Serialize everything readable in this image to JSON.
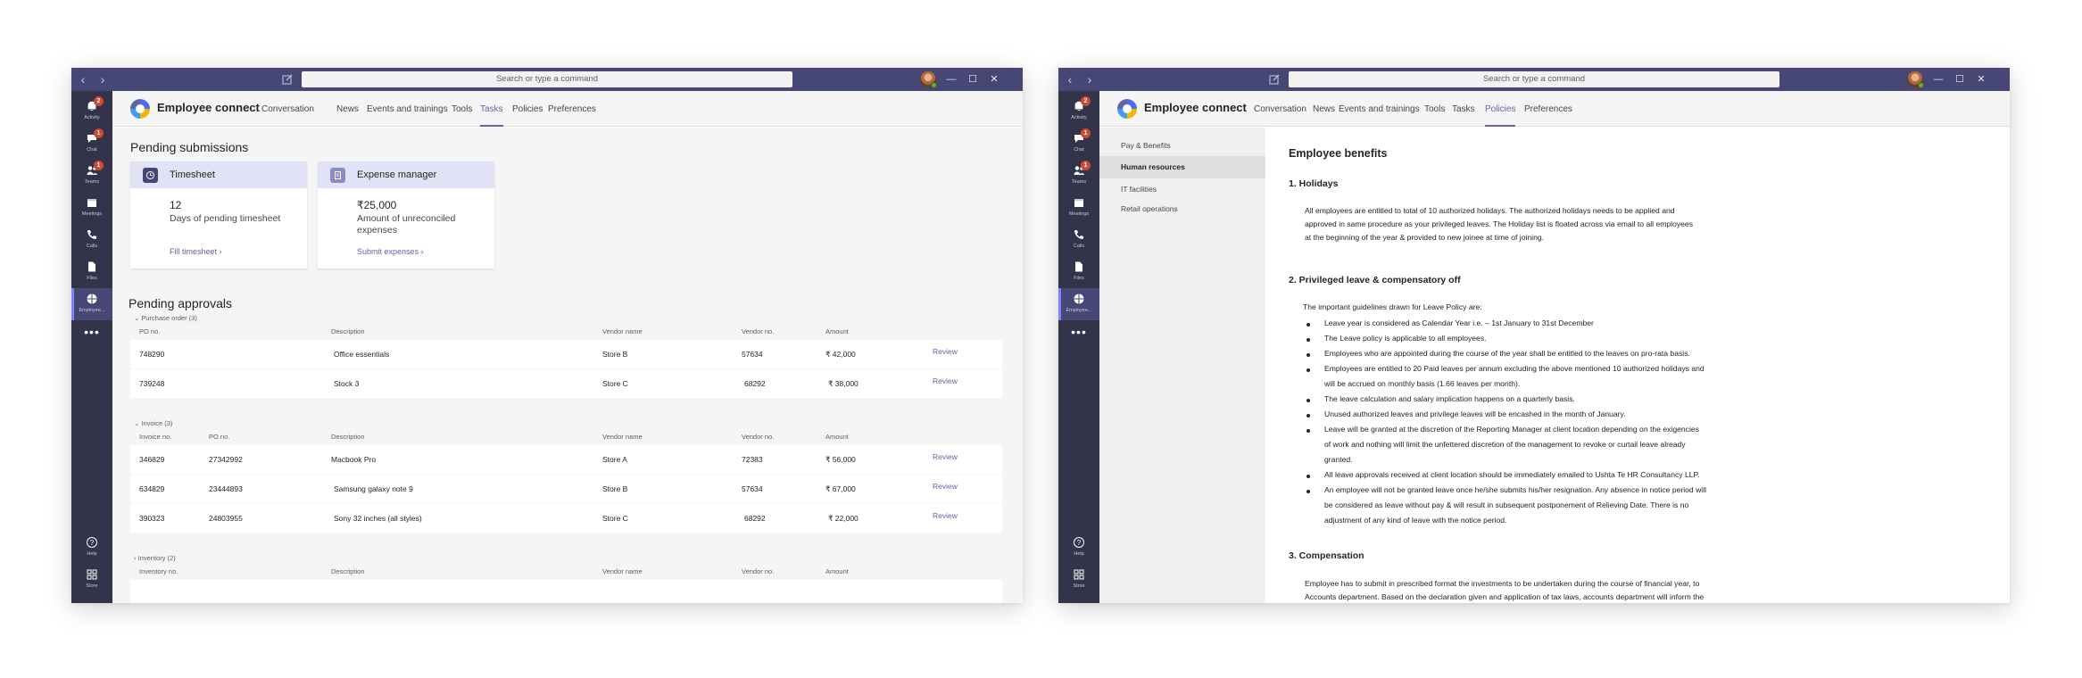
{
  "rail": [
    {
      "label": "Activity",
      "icon": "bell-icon",
      "badge": "2"
    },
    {
      "label": "Chat",
      "icon": "chat-icon",
      "badge": "1"
    },
    {
      "label": "Teams",
      "icon": "teams-icon",
      "badge": "1"
    },
    {
      "label": "Meetings",
      "icon": "calendar-icon",
      "badge": ""
    },
    {
      "label": "Calls",
      "icon": "phone-icon",
      "badge": ""
    },
    {
      "label": "Files",
      "icon": "file-icon",
      "badge": ""
    },
    {
      "label": "Employee...",
      "icon": "employee-connect-icon",
      "badge": ""
    }
  ],
  "rail_more": "•••",
  "rail_bottom": [
    {
      "label": "Help",
      "icon": "help-icon"
    },
    {
      "label": "Store",
      "icon": "store-icon"
    }
  ],
  "titlebar": {
    "search_text": "Search or type a command",
    "minimize": "—",
    "maximize": "☐",
    "close": "✕"
  },
  "app": {
    "name": "Employee connect",
    "tabs": [
      "Conversation",
      "News",
      "Events and trainings",
      "Tools",
      "Tasks",
      "Policies",
      "Preferences"
    ]
  },
  "left": {
    "active_tab": "Tasks",
    "pending_submissions_title": "Pending submissions",
    "cards": [
      {
        "title": "Timesheet",
        "value": "12",
        "desc": "Days of pending timesheet",
        "link": "Fill timesheet",
        "icon": "timesheet-icon"
      },
      {
        "title": "Expense manager",
        "value": "₹25,000",
        "desc": "Amount of unreconciled expenses",
        "link": "Submit expenses",
        "icon": "receipt-icon"
      }
    ],
    "pending_approvals_title": "Pending approvals",
    "groups": {
      "po": {
        "label": "Purchase order (3)",
        "headers": [
          "PO no.",
          "Description",
          "Vendor name",
          "Vendor no.",
          "Amount"
        ],
        "rows": [
          [
            "748290",
            "Office essentials",
            "Store B",
            "57634",
            "₹ 42,000",
            "Review"
          ],
          [
            "739248",
            "Stock 3",
            "Store C",
            "68292",
            "₹ 38,000",
            "Review"
          ]
        ]
      },
      "invoice": {
        "label": "Invoice (3)",
        "headers": [
          "Invoice no.",
          "PO no.",
          "Description",
          "Vendor name",
          "Vendor no.",
          "Amount"
        ],
        "rows": [
          [
            "346829",
            "27342992",
            "Macbook Pro",
            "Store A",
            "72383",
            "₹ 56,000",
            "Review"
          ],
          [
            "634829",
            "23444893",
            "Samsung galaxy note 9",
            "Store B",
            "57634",
            "₹ 67,000",
            "Review"
          ],
          [
            "390323",
            "24803955",
            "Sony 32 inches (all styles)",
            "Store C",
            "68292",
            "₹ 22,000",
            "Review"
          ]
        ]
      },
      "inventory": {
        "label": "Inventory (2)",
        "headers": [
          "Inventory no.",
          "Description",
          "Vendor name",
          "Vendor no.",
          "Amount"
        ]
      }
    }
  },
  "right": {
    "active_tab": "Policies",
    "sidenav": [
      "Pay & Benefits",
      "Human resources",
      "IT facilities",
      "Retail operations"
    ],
    "sidenav_active": "Human resources",
    "doc_title": "Employee benefits",
    "s1_title": "1.   Holidays",
    "s1_lines": [
      "All employees are entitled to total of 10 authorized holidays. The authorized holidays needs to be applied and",
      "approved in same procedure as your privileged leaves. The Holiday list is floated across via email to all employees",
      "at the beginning of the year & provided to new joinee at time of joining."
    ],
    "s2_title": "2.   Privileged leave & compensatory off",
    "s2_intro": "The important guidelines drawn for Leave Policy are:",
    "s2_bullets": [
      [
        "Leave year is considered as Calendar Year i.e. – 1st January to 31st December"
      ],
      [
        "The Leave policy is applicable to all employees."
      ],
      [
        "Employees who are appointed during the course of the year shall be entitled to the leaves on pro-rata basis."
      ],
      [
        "Employees are entitled to 20 Paid leaves per annum excluding the above mentioned 10 authorized holidays and",
        "will be accrued on monthly basis (1.66 leaves per month)."
      ],
      [
        "The leave calculation and salary implication happens on a quarterly basis."
      ],
      [
        "Unused authorized leaves and privilege leaves will be encashed in the month of January."
      ],
      [
        "Leave will be granted at the discretion of the Reporting Manager at client location depending on the exigencies",
        "of work and nothing will limit the unfettered discretion of the management to revoke or curtail leave already",
        "granted."
      ],
      [
        "All leave approvals received at client location should be immediately emailed to Ushta Te HR Consultancy LLP."
      ],
      [
        "An employee will not be granted leave once he/she submits his/her resignation. Any absence in notice period will",
        "be considered as leave without pay & will result in subsequent postponement of Relieving Date. There is no",
        "adjustment of any kind of leave with the notice period."
      ]
    ],
    "s3_title": "3.   Compensation",
    "s3_lines": [
      "Employee has to submit in prescribed format the investments to be undertaken during the course of financial year, to",
      "Accounts department. Based on the declaration given and application of tax laws, accounts department will inform the"
    ]
  },
  "colors": {
    "titlebar": "#464775",
    "rail": "#33344a",
    "accent": "#6264a7",
    "card_header": "#e2e2f6",
    "badge": "#cc4a31"
  }
}
